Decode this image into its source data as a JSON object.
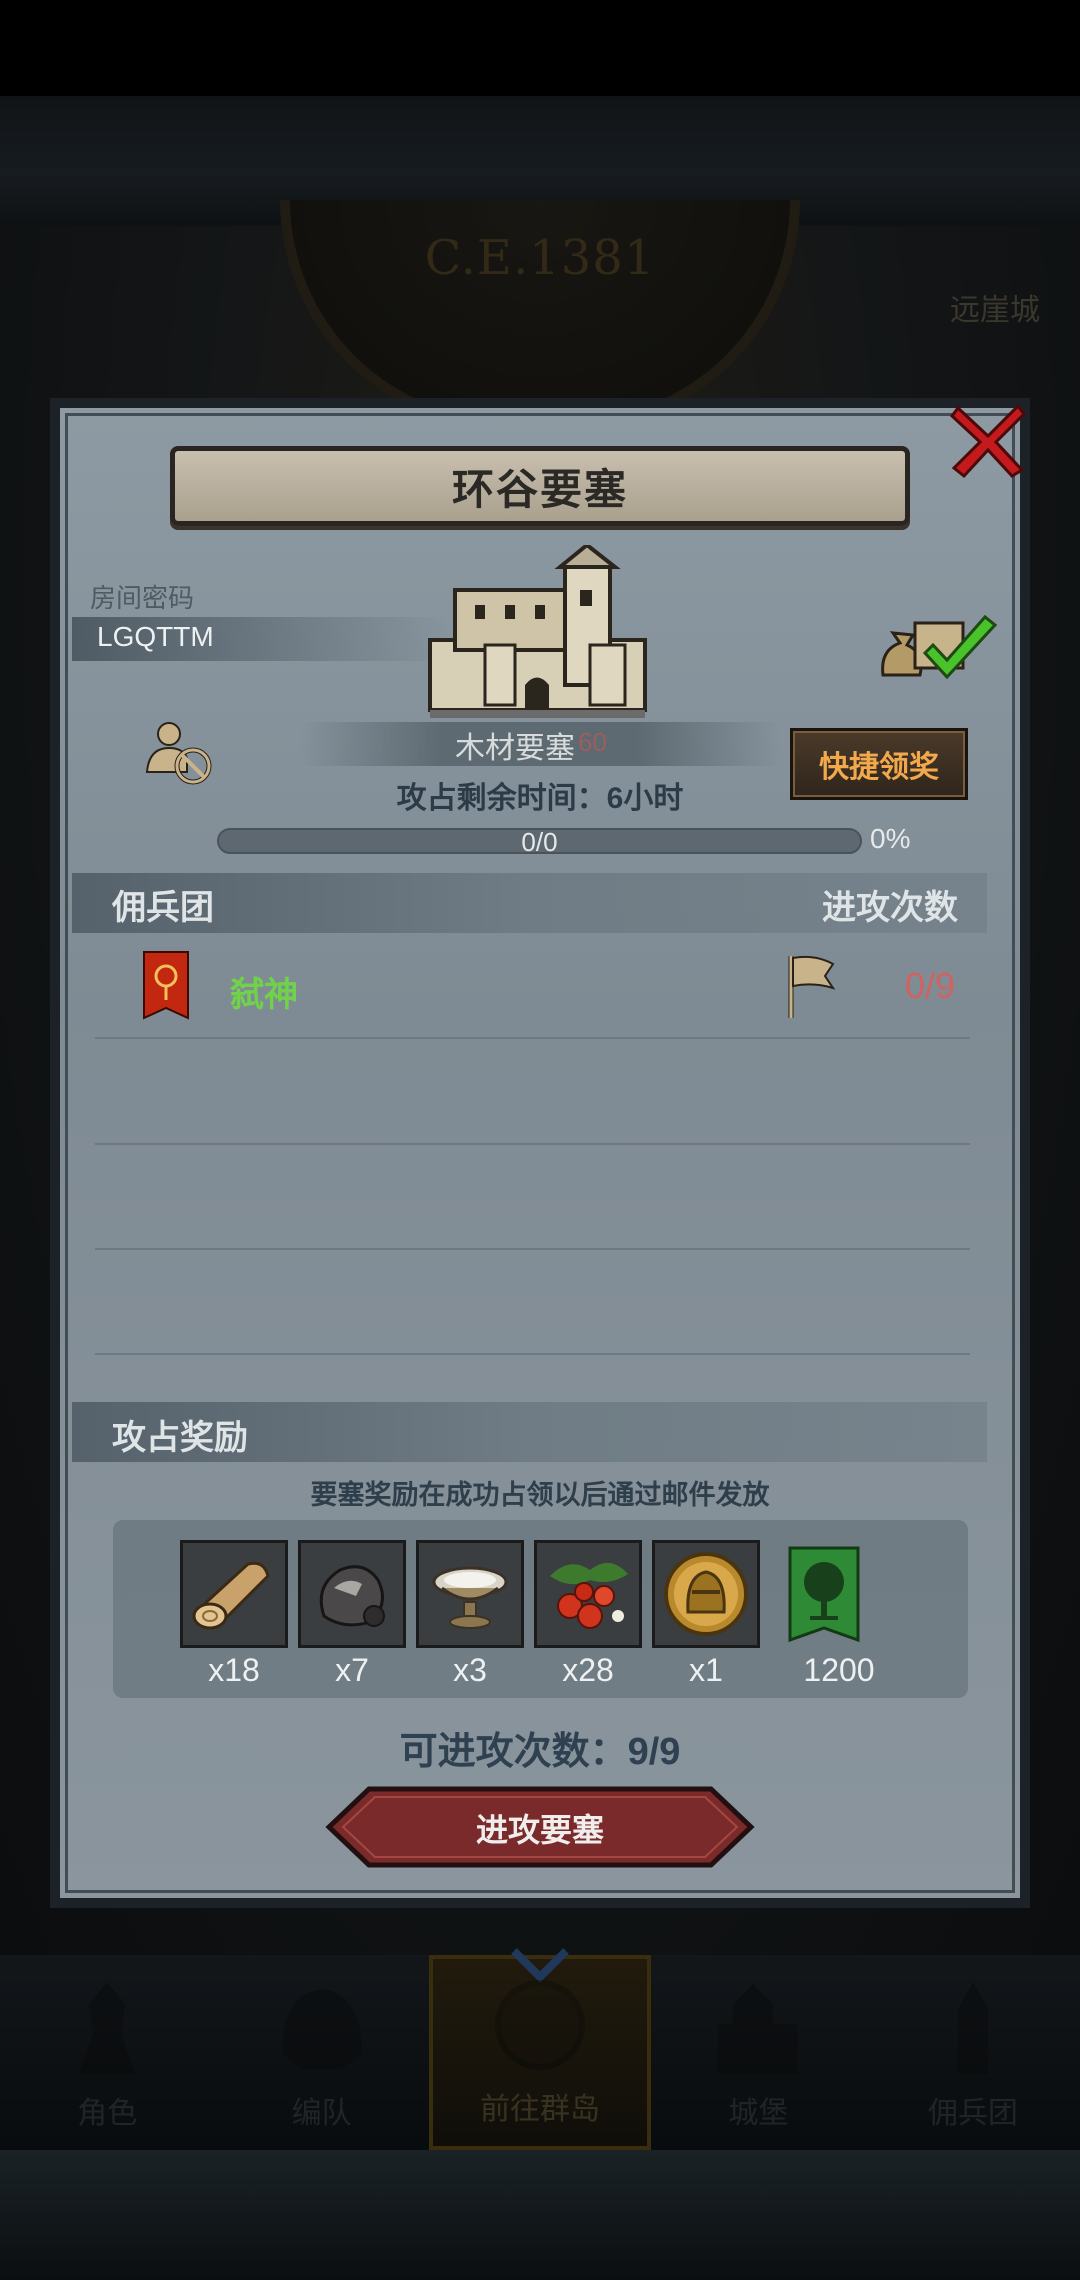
{
  "background": {
    "era": "C.E.1381",
    "town": "远崖城"
  },
  "dialog": {
    "title": "环谷要塞",
    "room_label": "房间密码",
    "room_code": "LGQTTM",
    "building_name": "木材要塞",
    "building_value": "60",
    "quick_claim": "快捷领奖",
    "time_remaining": "攻占剩余时间：6小时",
    "progress_text": "0/0",
    "progress_percent_text": "0%",
    "progress_fraction": 0,
    "mercenary_header": "佣兵团",
    "attacks_header": "进攻次数",
    "guilds": [
      {
        "name": "弑神",
        "attacks": "0/9"
      }
    ],
    "rewards_header": "攻占奖励",
    "rewards_note": "要塞奖励在成功占领以后通过邮件发放",
    "rewards": [
      {
        "icon": "wood-log-icon",
        "count": "x18"
      },
      {
        "icon": "ore-rock-icon",
        "count": "x7"
      },
      {
        "icon": "offering-bowl-icon",
        "count": "x3"
      },
      {
        "icon": "berries-icon",
        "count": "x28"
      },
      {
        "icon": "knight-helmet-medal-icon",
        "count": "x1"
      },
      {
        "icon": "tree-banner-icon",
        "count": "1200"
      }
    ],
    "available_attacks": "可进攻次数：9/9",
    "attack_button": "进攻要塞"
  },
  "bottom_nav": [
    {
      "label": "角色",
      "icon": "knight-icon",
      "active": false
    },
    {
      "label": "编队",
      "icon": "helmet-icon",
      "active": false
    },
    {
      "label": "前往群岛",
      "icon": "globe-icon",
      "active": true
    },
    {
      "label": "城堡",
      "icon": "castle-icon",
      "active": false
    },
    {
      "label": "佣兵团",
      "icon": "tower-icon",
      "active": false
    }
  ],
  "colors": {
    "guild_name": "#6fd24a",
    "attack_count": "#d16262",
    "quick_claim_text": "#f2a94c",
    "attack_button": "#7a2a2a"
  }
}
